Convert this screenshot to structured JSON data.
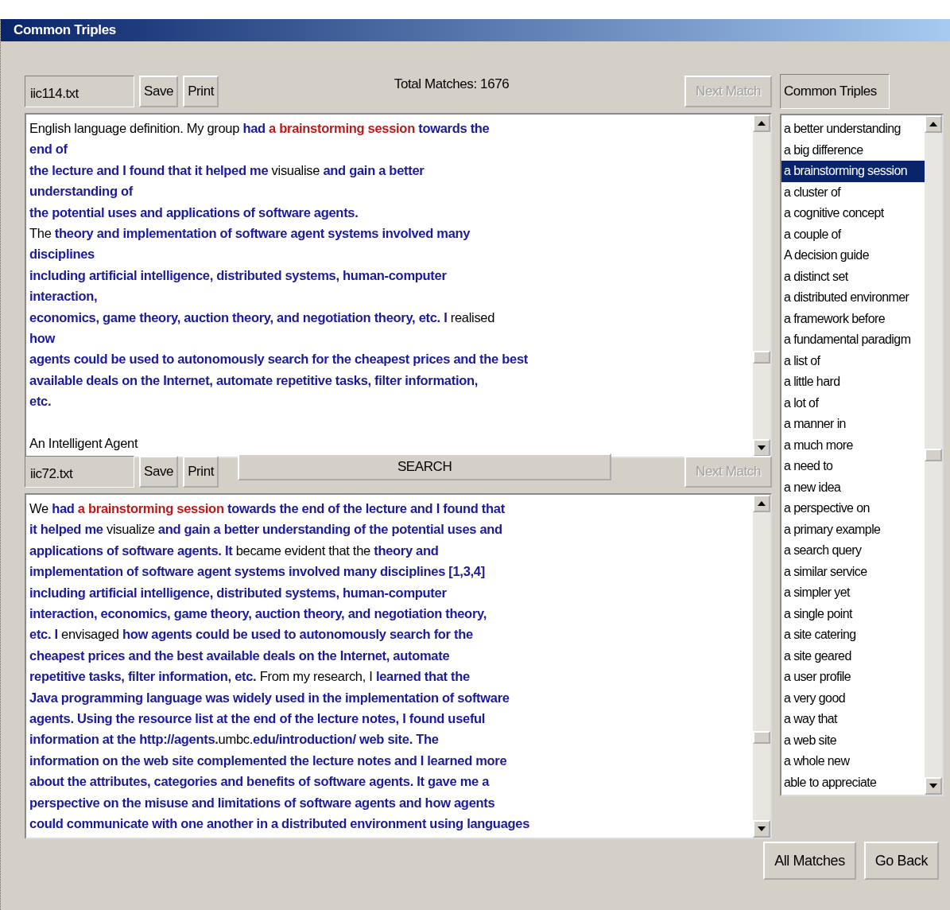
{
  "window": {
    "title": "Common Triples"
  },
  "top_panel": {
    "file_name": "iic114.txt",
    "buttons": [
      "Save",
      "Print"
    ],
    "total_matches": "Total Matches: 1676",
    "next_match": {
      "label": "Next Match",
      "disabled": true
    },
    "lines": [
      {
        "segments": [
          {
            "kind": "plain",
            "text": "English language definition. My group "
          },
          {
            "kind": "common",
            "text": "had "
          },
          {
            "kind": "query",
            "text": "a brainstorming session"
          },
          {
            "kind": "common",
            "text": " towards the"
          }
        ]
      },
      {
        "segments": [
          {
            "kind": "common",
            "text": "end of"
          }
        ]
      },
      {
        "segments": [
          {
            "kind": "common",
            "text": "the lecture and I found that it helped me "
          },
          {
            "kind": "plain",
            "text": "visualise "
          },
          {
            "kind": "common",
            "text": "and gain a better"
          }
        ]
      },
      {
        "segments": [
          {
            "kind": "common",
            "text": "understanding of"
          }
        ]
      },
      {
        "segments": [
          {
            "kind": "common",
            "text": "the potential uses and applications of software agents."
          }
        ]
      },
      {
        "segments": [
          {
            "kind": "plain",
            "text": "The "
          },
          {
            "kind": "common",
            "text": "theory and implementation of software agent systems involved many"
          }
        ]
      },
      {
        "segments": [
          {
            "kind": "common",
            "text": "disciplines"
          }
        ]
      },
      {
        "segments": [
          {
            "kind": "common",
            "text": "including artificial intelligence, distributed systems, human-computer"
          }
        ]
      },
      {
        "segments": [
          {
            "kind": "common",
            "text": "interaction,"
          }
        ]
      },
      {
        "segments": [
          {
            "kind": "common",
            "text": "economics, game theory, auction theory, and negotiation theory, etc. I "
          },
          {
            "kind": "plain",
            "text": "realised"
          }
        ]
      },
      {
        "segments": [
          {
            "kind": "common",
            "text": "how"
          }
        ]
      },
      {
        "segments": [
          {
            "kind": "common",
            "text": "agents could be used to autonomously search for the cheapest prices and the best"
          }
        ]
      },
      {
        "segments": [
          {
            "kind": "common",
            "text": "available deals on the Internet, automate repetitive tasks, filter information,"
          }
        ]
      },
      {
        "segments": [
          {
            "kind": "common",
            "text": "etc."
          }
        ]
      }
    ],
    "next_paragraph": {
      "segments": [
        {
          "kind": "plain",
          "text": "An Intelligent Agent"
        }
      ]
    }
  },
  "bottom_panel": {
    "file_name": "iic72.txt",
    "buttons": [
      "Save",
      "Print"
    ],
    "search_button": "SEARCH",
    "next_match": {
      "label": "Next Match",
      "disabled": true
    },
    "lines": [
      {
        "segments": [
          {
            "kind": "plain",
            "text": "We "
          },
          {
            "kind": "common",
            "text": "had "
          },
          {
            "kind": "query",
            "text": "a brainstorming session"
          },
          {
            "kind": "common",
            "text": " towards the end of the lecture and I found that"
          }
        ]
      },
      {
        "segments": [
          {
            "kind": "common",
            "text": "it helped me "
          },
          {
            "kind": "plain",
            "text": "visualize "
          },
          {
            "kind": "common",
            "text": "and gain a better understanding of the potential uses and"
          }
        ]
      },
      {
        "segments": [
          {
            "kind": "common",
            "text": "applications of software agents. It "
          },
          {
            "kind": "plain",
            "text": "became evident that the "
          },
          {
            "kind": "common",
            "text": "theory and"
          }
        ]
      },
      {
        "segments": [
          {
            "kind": "common",
            "text": "implementation of software agent systems involved many disciplines [1,3,4]"
          }
        ]
      },
      {
        "segments": [
          {
            "kind": "common",
            "text": "including artificial intelligence, distributed systems, human-computer"
          }
        ]
      },
      {
        "segments": [
          {
            "kind": "common",
            "text": "interaction, economics, game theory, auction theory, and negotiation theory,"
          }
        ]
      },
      {
        "segments": [
          {
            "kind": "common",
            "text": "etc. I "
          },
          {
            "kind": "plain",
            "text": "envisaged "
          },
          {
            "kind": "common",
            "text": "how agents could be used to autonomously search for the"
          }
        ]
      },
      {
        "segments": [
          {
            "kind": "common",
            "text": "cheapest prices and the best available deals on the Internet, automate"
          }
        ]
      },
      {
        "segments": [
          {
            "kind": "common",
            "text": "repetitive tasks, filter information, etc. "
          },
          {
            "kind": "plain",
            "text": "From my research, I "
          },
          {
            "kind": "common",
            "text": "learned that the"
          }
        ]
      },
      {
        "segments": [
          {
            "kind": "common",
            "text": "Java programming language was widely used in the implementation of software"
          }
        ]
      },
      {
        "segments": [
          {
            "kind": "common",
            "text": "agents. Using the resource list at the end of the lecture notes, I found useful"
          }
        ]
      },
      {
        "segments": [
          {
            "kind": "common",
            "text": "information at the http://agents."
          },
          {
            "kind": "plain",
            "text": "umbc."
          },
          {
            "kind": "common",
            "text": "edu/introduction/ web site. The"
          }
        ]
      },
      {
        "segments": [
          {
            "kind": "common",
            "text": "information on the web site complemented the lecture notes and I learned more"
          }
        ]
      },
      {
        "segments": [
          {
            "kind": "common",
            "text": "about the attributes, categories and benefits of software agents. It gave me a"
          }
        ]
      },
      {
        "segments": [
          {
            "kind": "common",
            "text": "perspective on the misuse and limitations of software agents and how agents"
          }
        ]
      },
      {
        "segments": [
          {
            "kind": "common",
            "text": "could communicate with one another in a distributed environment using languages"
          }
        ]
      }
    ]
  },
  "triples_panel": {
    "label": "Common Triples",
    "items": [
      {
        "label": "a better understanding",
        "selected": false
      },
      {
        "label": "a big difference",
        "selected": false
      },
      {
        "label": "a brainstorming session",
        "selected": true
      },
      {
        "label": "a cluster of",
        "selected": false
      },
      {
        "label": "a cognitive concept",
        "selected": false
      },
      {
        "label": "a couple of",
        "selected": false
      },
      {
        "label": "A decision guide",
        "selected": false
      },
      {
        "label": "a distinct set",
        "selected": false
      },
      {
        "label": "a distributed environmer",
        "selected": false
      },
      {
        "label": "a framework before",
        "selected": false
      },
      {
        "label": "a fundamental paradigm",
        "selected": false
      },
      {
        "label": "a list of",
        "selected": false
      },
      {
        "label": "a little hard",
        "selected": false
      },
      {
        "label": "a lot of",
        "selected": false
      },
      {
        "label": "a manner in",
        "selected": false
      },
      {
        "label": "a much more",
        "selected": false
      },
      {
        "label": "a need to",
        "selected": false
      },
      {
        "label": "a new idea",
        "selected": false
      },
      {
        "label": "a perspective on",
        "selected": false
      },
      {
        "label": "a primary example",
        "selected": false
      },
      {
        "label": "a search query",
        "selected": false
      },
      {
        "label": "a similar service",
        "selected": false
      },
      {
        "label": "a simpler yet",
        "selected": false
      },
      {
        "label": "a single point",
        "selected": false
      },
      {
        "label": "a site catering",
        "selected": false
      },
      {
        "label": "a site geared",
        "selected": false
      },
      {
        "label": "a user profile",
        "selected": false
      },
      {
        "label": "a very good",
        "selected": false
      },
      {
        "label": "a way that",
        "selected": false
      },
      {
        "label": "a web site",
        "selected": false
      },
      {
        "label": "a whole new",
        "selected": false
      },
      {
        "label": "able to appreciate",
        "selected": false
      }
    ]
  },
  "footer_buttons": [
    "All Matches",
    "Go Back"
  ]
}
